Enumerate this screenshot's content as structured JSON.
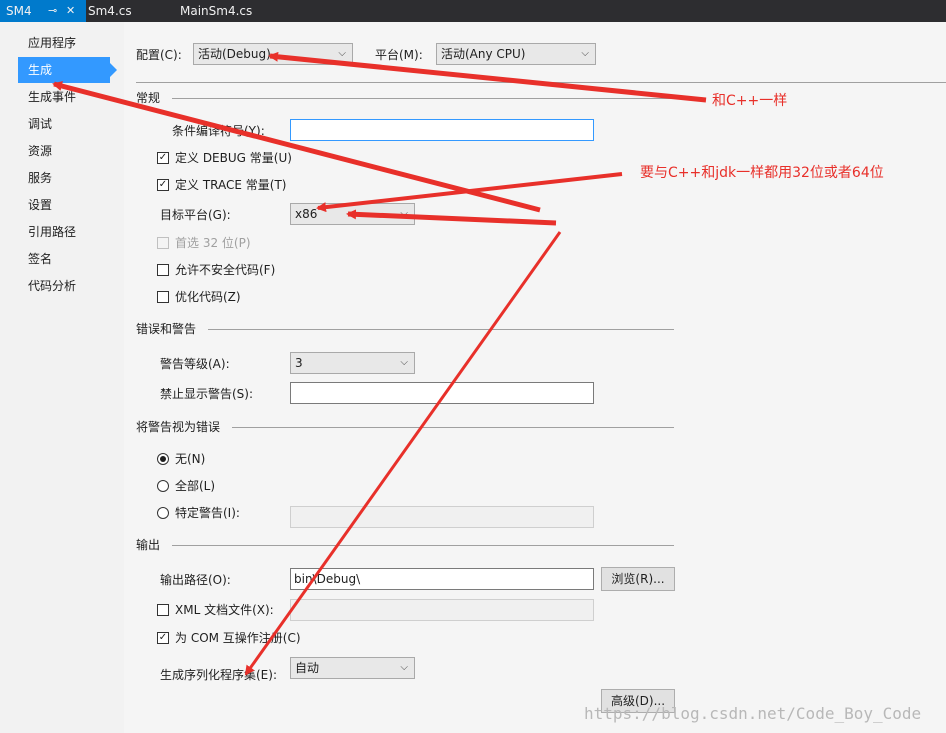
{
  "tabs": [
    {
      "label": "SM4",
      "active": true
    },
    {
      "label": "Sm4.cs",
      "active": false
    },
    {
      "label": "MainSm4.cs",
      "active": false
    }
  ],
  "sidebar": {
    "items": [
      "应用程序",
      "生成",
      "生成事件",
      "调试",
      "资源",
      "服务",
      "设置",
      "引用路径",
      "签名",
      "代码分析"
    ],
    "active_index": 1
  },
  "top": {
    "config_label": "配置(C):",
    "config_value": "活动(Debug)",
    "platform_label": "平台(M):",
    "platform_value": "活动(Any CPU)"
  },
  "general": {
    "section": "常规",
    "cond_symbols_label": "条件编译符号(Y):",
    "cond_symbols_value": "",
    "define_debug": "定义 DEBUG 常量(U)",
    "define_trace": "定义 TRACE 常量(T)",
    "target_label": "目标平台(G):",
    "target_value": "x86",
    "prefer32": "首选 32 位(P)",
    "unsafe": "允许不安全代码(F)",
    "optimize": "优化代码(Z)"
  },
  "errors": {
    "section": "错误和警告",
    "warning_level_label": "警告等级(A):",
    "warning_level_value": "3",
    "suppress_label": "禁止显示警告(S):",
    "suppress_value": ""
  },
  "treat": {
    "section": "将警告视为错误",
    "none": "无(N)",
    "all": "全部(L)",
    "specific": "特定警告(I):"
  },
  "output": {
    "section": "输出",
    "path_label": "输出路径(O):",
    "path_value": "bin\\Debug\\",
    "browse": "浏览(R)...",
    "xml_doc": "XML 文档文件(X):",
    "com_reg": "为 COM 互操作注册(C)",
    "serial_label": "生成序列化程序集(E):",
    "serial_value": "自动",
    "advanced": "高级(D)..."
  },
  "annotations": {
    "note1": "和C++一样",
    "note2": "要与C++和jdk一样都用32位或者64位"
  },
  "watermark": "https://blog.csdn.net/Code_Boy_Code",
  "colors": {
    "accent": "#007acc",
    "selected": "#3399ff",
    "annotation": "#e8302a"
  }
}
